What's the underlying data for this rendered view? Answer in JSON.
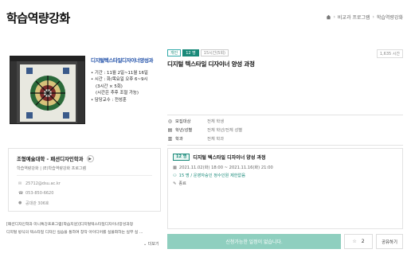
{
  "page": {
    "title": "학습역량강화"
  },
  "breadcrumb": {
    "items": [
      "비교과 프로그램",
      "학습역량강화"
    ]
  },
  "poster": {
    "title": "디지털텍스타일디자이너양성과",
    "info": [
      "• 기간 : 11월 2일~11월 16일",
      "• 시간 : 화/목요일 오후 6~9시",
      "  (3시간 × 5회)",
      "  (시간은 추후 조절 가능)",
      "• 담당교수 : 전성훈"
    ]
  },
  "org": {
    "name": "조형예술대학 - 패션디자인학과",
    "sub": "학습역량강화 | (E)학습역량강화 프로그램",
    "rows": [
      {
        "icon": "mail-icon",
        "text": "25712@dsu.ac.kr"
      },
      {
        "icon": "phone-icon",
        "text": "053-850-6620"
      },
      {
        "icon": "location-icon",
        "text": "공대관 306호"
      }
    ]
  },
  "description": {
    "line1": "[패션디자인학과 미니특강프로그램(학습지원)]디지털텍스타일디자이너양성과정",
    "line2": "디지털 방식의 텍스타일 디자인 실습을 통하여 창작 아이디어를 실물화하는 실무 실 ...",
    "more": "⌄ 더보기"
  },
  "course": {
    "tags": [
      "개인",
      "12 명",
      "15시간(5회)"
    ],
    "views": "1,635 시간",
    "title": "디지털 텍스타일 디자이너 양성 과정",
    "info": [
      {
        "icon": "target-icon",
        "key": "모집대상",
        "value": "전체 학생"
      },
      {
        "icon": "grade-icon",
        "key": "학년/성별",
        "value": "전체 학년/전체 성별"
      },
      {
        "icon": "building-icon",
        "key": "학과",
        "value": "전체 학과"
      }
    ]
  },
  "session": {
    "badge": "12 명",
    "title": "디지털 텍스타일 디자이너 양성 과정",
    "date": "2021.11.02(화) 18:00 ~ 2021.11.16(화) 21:00",
    "capacity": "15 명 / 운영자승인 정수인원 제한없음",
    "status": "종료"
  },
  "actions": {
    "apply": "신청가능한 일정이 없습니다.",
    "like_count": "2",
    "share": "공유하기"
  },
  "colors": {
    "accent": "#1a8a7a",
    "apply_bg": "#8fcfbf",
    "poster_title": "#1f4fa8"
  }
}
